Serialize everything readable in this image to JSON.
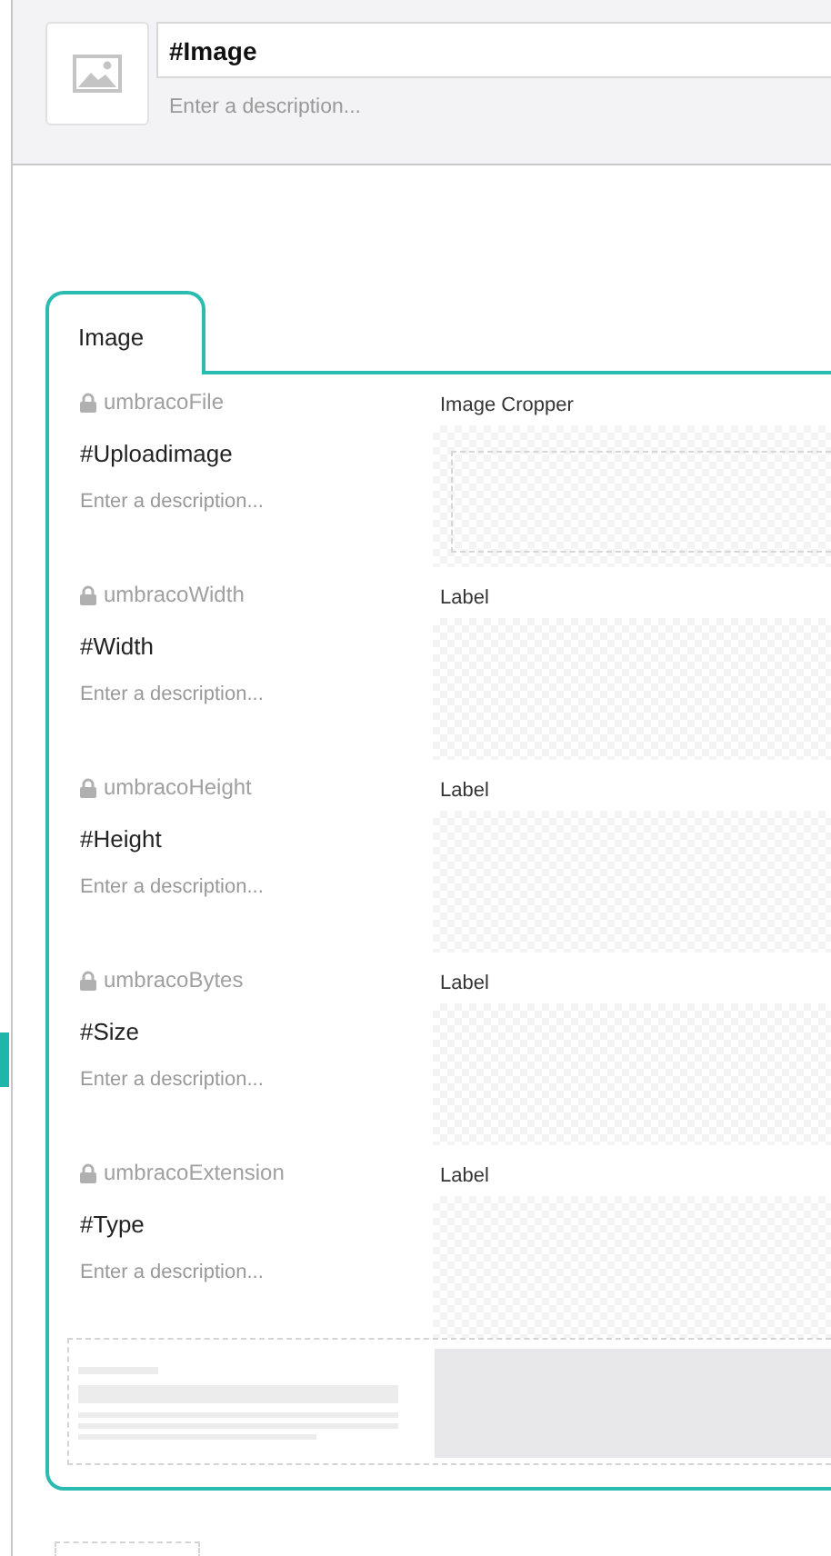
{
  "header": {
    "name": "#Image",
    "description_placeholder": "Enter a description..."
  },
  "tab": {
    "label": "Image"
  },
  "properties": [
    {
      "alias": "umbracoFile",
      "name": "#Uploadimage",
      "description_placeholder": "Enter a description...",
      "editor": "Image Cropper",
      "kind": "cropper"
    },
    {
      "alias": "umbracoWidth",
      "name": "#Width",
      "description_placeholder": "Enter a description...",
      "editor": "Label",
      "kind": "label"
    },
    {
      "alias": "umbracoHeight",
      "name": "#Height",
      "description_placeholder": "Enter a description...",
      "editor": "Label",
      "kind": "label"
    },
    {
      "alias": "umbracoBytes",
      "name": "#Size",
      "description_placeholder": "Enter a description...",
      "editor": "Label",
      "kind": "label"
    },
    {
      "alias": "umbracoExtension",
      "name": "#Type",
      "description_placeholder": "Enter a description...",
      "editor": "Label",
      "kind": "label"
    }
  ]
}
